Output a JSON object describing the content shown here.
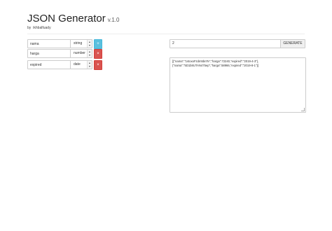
{
  "header": {
    "title": "JSON Generator",
    "version": "v.1.0",
    "by_label": "by",
    "author": "ikhbalfuady"
  },
  "fields": [
    {
      "name": "nama",
      "type": "string",
      "action_symbol": "+",
      "action": "add"
    },
    {
      "name": "harga",
      "type": "number",
      "action_symbol": "×",
      "action": "remove"
    },
    {
      "name": "expired",
      "type": "date",
      "action_symbol": "×",
      "action": "remove"
    }
  ],
  "generator": {
    "count_value": "2",
    "generate_label": "GENERATE",
    "output_lines": [
      "[{\"nama\":\"1stoxoFzdm5bnTe\",\"harga\":72240,\"expired\":\"2019-4-3\"},",
      "{\"nama\":\"5D1b8UTAN475ep\",\"harga\":58966,\"expired\":\"2019-8-1\"}]"
    ]
  },
  "colors": {
    "add_button": "#5bc0de",
    "remove_button": "#d9534f"
  },
  "icons": {
    "select_chevron": "chevron-updown-icon",
    "textarea_grip": "resize-grip-icon"
  }
}
